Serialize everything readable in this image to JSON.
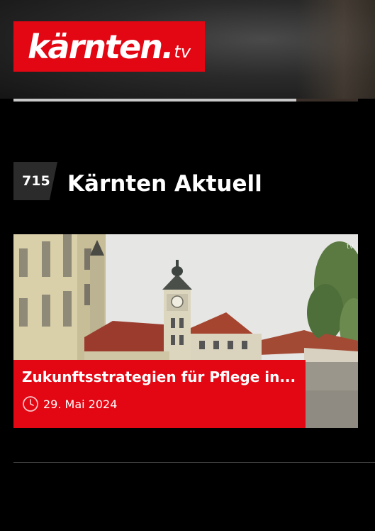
{
  "logo": {
    "main": "kärnten.",
    "suffix": "tv"
  },
  "player": {
    "progress_fraction": 0.82
  },
  "section": {
    "channel_number": "715",
    "title": "Kärnten Aktuell"
  },
  "video": {
    "title": "Zukunftsstrategien für Pflege in...",
    "date": "29. Mai 2024",
    "watermark": "tv"
  },
  "icons": {
    "time": "clock-icon"
  },
  "colors": {
    "brand_red": "#e30613",
    "badge_gray": "#2b2b2b",
    "background": "#000000"
  }
}
